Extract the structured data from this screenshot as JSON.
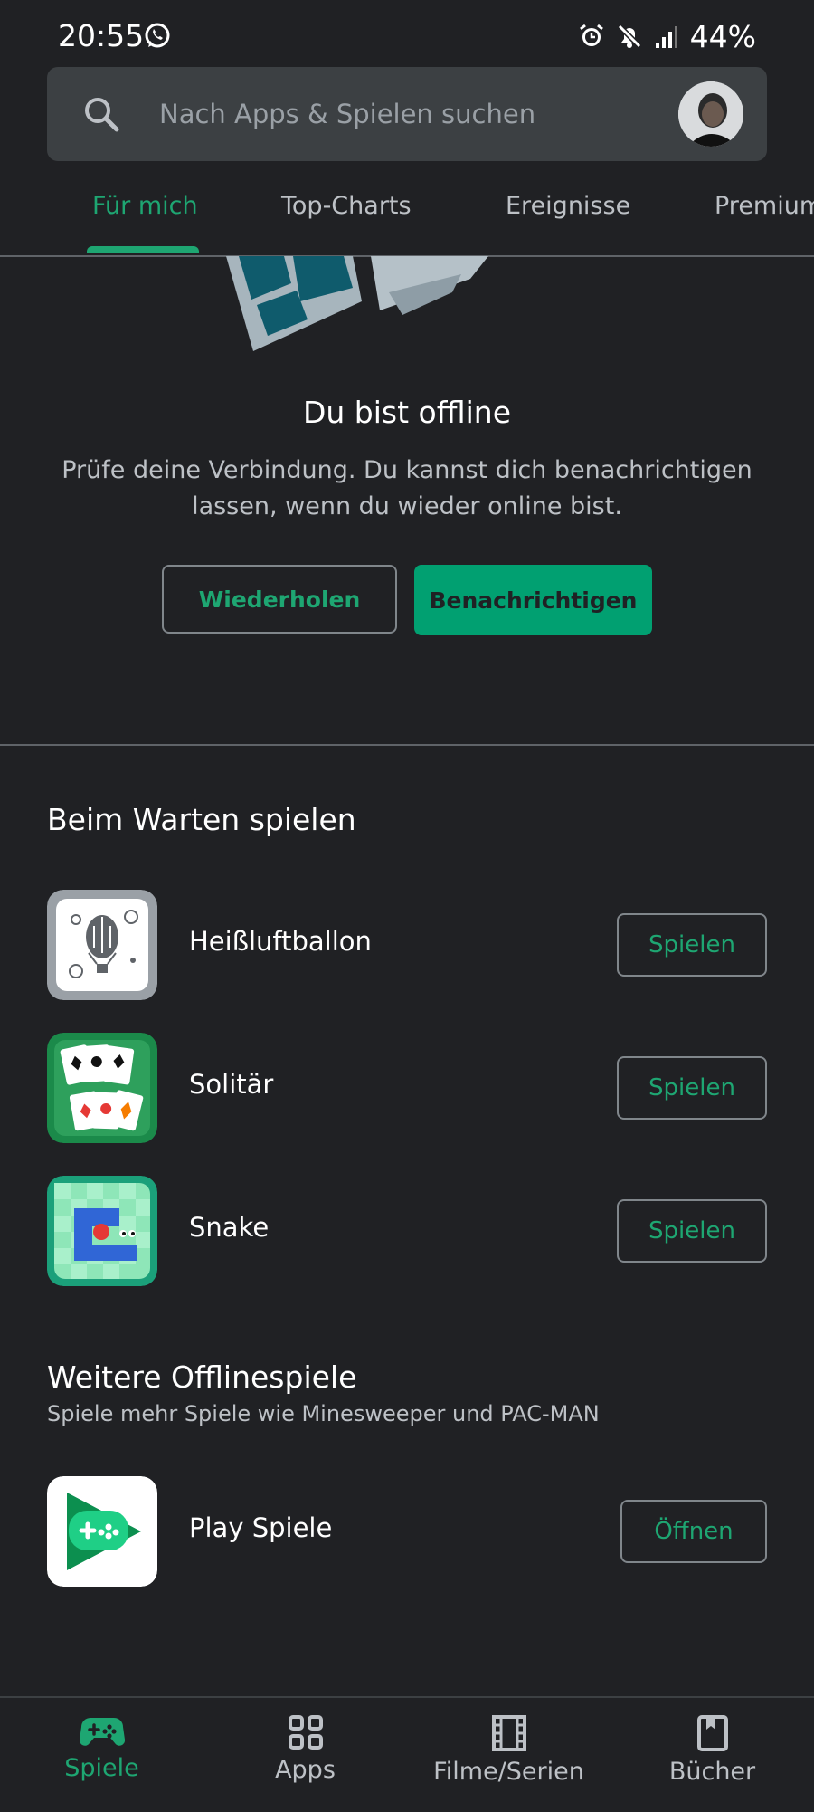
{
  "status_bar": {
    "time": "20:55",
    "battery": "44%"
  },
  "search": {
    "placeholder": "Nach Apps & Spielen suchen"
  },
  "tabs": [
    {
      "label": "Für mich",
      "active": true
    },
    {
      "label": "Top-Charts",
      "active": false
    },
    {
      "label": "Ereignisse",
      "active": false
    },
    {
      "label": "Premium",
      "active": false
    }
  ],
  "offline": {
    "title": "Du bist offline",
    "description": "Prüfe deine Verbindung. Du kannst dich benachrichtigen lassen, wenn du wieder online bist.",
    "retry_label": "Wiederholen",
    "notify_label": "Benachrichtigen"
  },
  "play_while_waiting": {
    "title": "Beim Warten spielen",
    "games": [
      {
        "name": "Heißluftballon",
        "button": "Spielen",
        "icon": "hot-air-balloon-icon"
      },
      {
        "name": "Solitär",
        "button": "Spielen",
        "icon": "solitaire-icon"
      },
      {
        "name": "Snake",
        "button": "Spielen",
        "icon": "snake-icon"
      }
    ]
  },
  "more_offline": {
    "title": "Weitere Offlinespiele",
    "subtitle": "Spiele mehr Spiele wie Minesweeper und PAC-MAN",
    "app": {
      "name": "Play Spiele",
      "button": "Öffnen",
      "icon": "play-games-icon"
    }
  },
  "bottom_nav": [
    {
      "label": "Spiele",
      "icon": "gamepad-icon",
      "active": true
    },
    {
      "label": "Apps",
      "icon": "apps-grid-icon",
      "active": false
    },
    {
      "label": "Filme/Serien",
      "icon": "film-icon",
      "active": false
    },
    {
      "label": "Bücher",
      "icon": "book-icon",
      "active": false
    }
  ],
  "colors": {
    "accent": "#1ea672",
    "background": "#202124",
    "surface": "#3c4043",
    "filled_button": "#01a071"
  }
}
